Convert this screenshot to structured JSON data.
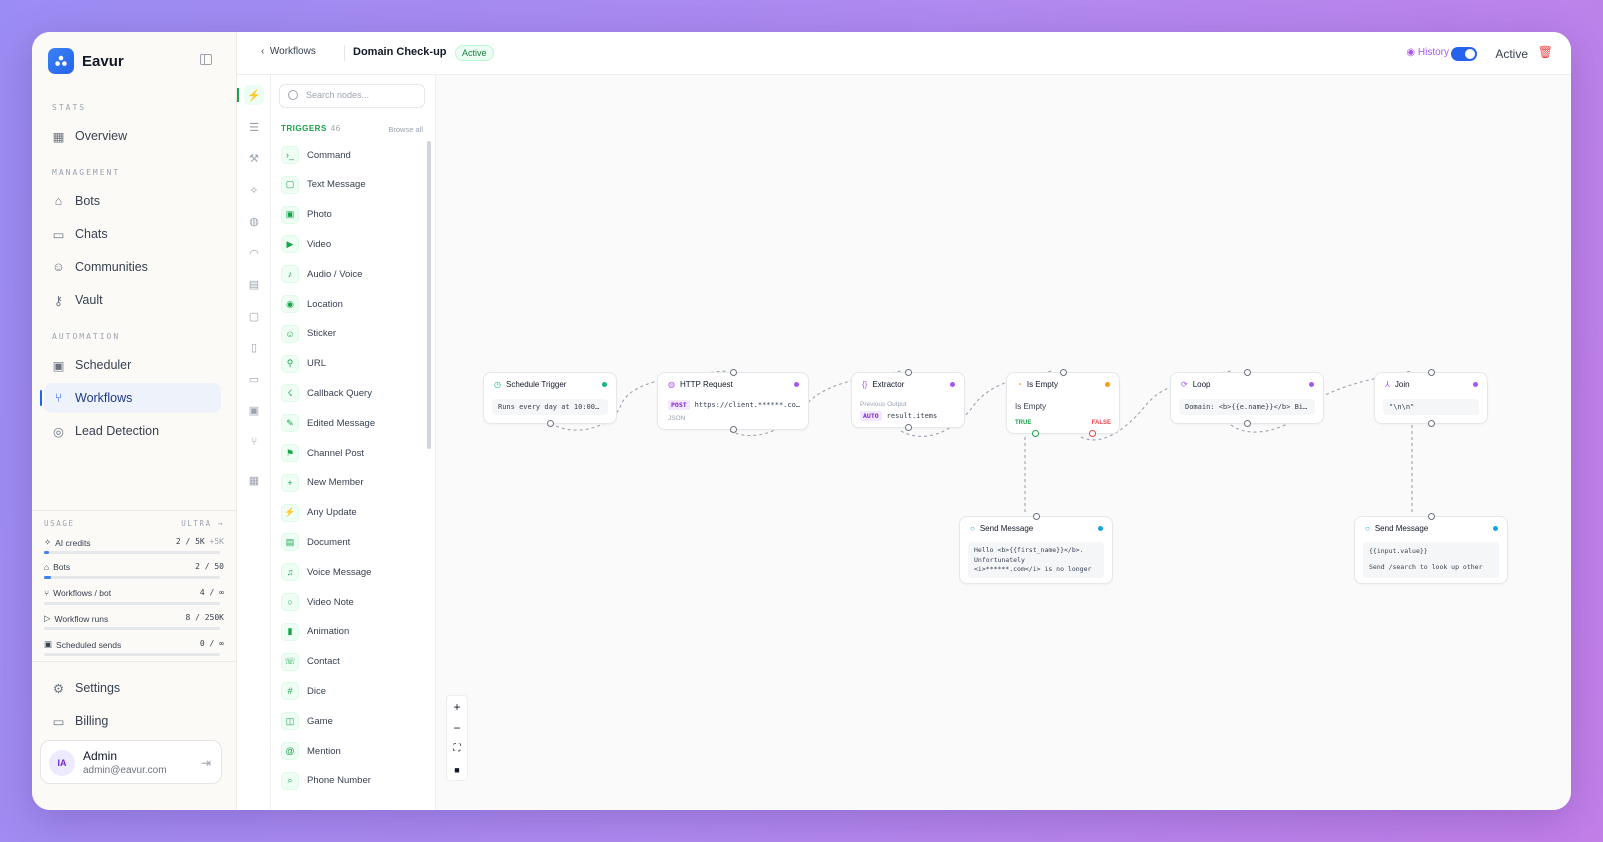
{
  "brand": {
    "name": "Eavur"
  },
  "sidebar": {
    "sections": {
      "stats": "STATS",
      "management": "MANAGEMENT",
      "automation": "AUTOMATION"
    },
    "items": [
      {
        "label": "Overview",
        "icon": "grid-icon"
      },
      {
        "label": "Bots",
        "icon": "bot-icon"
      },
      {
        "label": "Chats",
        "icon": "chat-icon"
      },
      {
        "label": "Communities",
        "icon": "users-icon"
      },
      {
        "label": "Vault",
        "icon": "key-icon"
      },
      {
        "label": "Scheduler",
        "icon": "calendar-icon"
      },
      {
        "label": "Workflows",
        "icon": "workflow-icon",
        "active": true
      },
      {
        "label": "Lead Detection",
        "icon": "target-icon"
      }
    ],
    "usage": {
      "title": "USAGE",
      "plan": "ULTRA →",
      "rows": [
        {
          "label": "AI credits",
          "value": "2 / 5K",
          "extra": "+5K",
          "fraction": 0.01
        },
        {
          "label": "Bots",
          "value": "2 / 50",
          "fraction": 0.04
        },
        {
          "label": "Workflows / bot",
          "value": "4 / ∞",
          "fraction": 0.0
        },
        {
          "label": "Workflow runs",
          "value": "8 / 250K",
          "fraction": 0.0
        },
        {
          "label": "Scheduled sends",
          "value": "0 / ∞",
          "fraction": 0.0
        }
      ]
    },
    "bottom": [
      {
        "label": "Settings",
        "icon": "gear-icon"
      },
      {
        "label": "Billing",
        "icon": "card-icon"
      }
    ],
    "user": {
      "initials": "IA",
      "name": "Admin",
      "email": "admin@eavur.com"
    }
  },
  "header": {
    "back": "Workflows",
    "title": "Domain Check-up",
    "status": "Active",
    "history": "History",
    "toggle_label": "Active",
    "toggle_on": true
  },
  "palette": {
    "search_placeholder": "Search nodes...",
    "group": "TRIGGERS",
    "count": "46",
    "browse": "Browse all",
    "items": [
      "Command",
      "Text Message",
      "Photo",
      "Video",
      "Audio / Voice",
      "Location",
      "Sticker",
      "URL",
      "Callback Query",
      "Edited Message",
      "Channel Post",
      "New Member",
      "Any Update",
      "Document",
      "Voice Message",
      "Video Note",
      "Animation",
      "Contact",
      "Dice",
      "Game",
      "Mention",
      "Phone Number"
    ]
  },
  "nodes": {
    "schedule": {
      "title": "Schedule Trigger",
      "body": "Runs every day at 10:00 AM",
      "color": "#10b981"
    },
    "http": {
      "title": "HTTP Request",
      "method": "POST",
      "url": "https://client.******.co…",
      "fmt": "JSON",
      "color": "#a855f7"
    },
    "extractor": {
      "title": "Extractor",
      "caption": "Previous Output",
      "mode": "AUTO",
      "path": "result.items",
      "color": "#a855f7"
    },
    "isempty": {
      "title": "Is Empty",
      "caption": "Is Empty",
      "true_label": "TRUE",
      "false_label": "FALSE",
      "color": "#f59e0b"
    },
    "loop": {
      "title": "Loop",
      "body": "Domain: <b>{{e.name}}</b> Bid…",
      "color": "#a855f7"
    },
    "join": {
      "title": "Join",
      "body": "\"\\n\\n\"",
      "color": "#a855f7"
    },
    "send1": {
      "title": "Send Message",
      "line1": "Hello <b>{{first_name}}</b>.",
      "line2": "Unfortunately",
      "line3": "<i>******.com</i> is no longer",
      "color": "#0ea5e9"
    },
    "send2": {
      "title": "Send Message",
      "line1": "{{input.value}}",
      "line2": "Send /search to look up other",
      "color": "#0ea5e9"
    }
  }
}
